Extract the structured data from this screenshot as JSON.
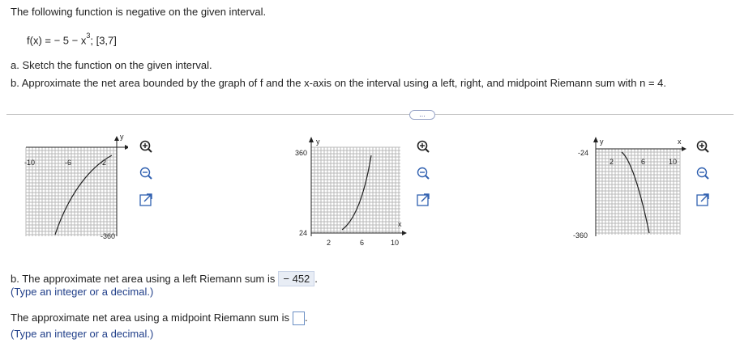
{
  "problem": {
    "intro": "The following function is negative on the given interval.",
    "function_prefix": "f(x) = − 5 − x",
    "function_exp": "3",
    "function_suffix": "; [3,7]",
    "part_a": "a. Sketch the function on the given interval.",
    "part_b": "b. Approximate the net area bounded by the graph of f and the x-axis on the interval using a left, right, and midpoint Riemann sum with n = 4."
  },
  "more_button": "...",
  "graphs": [
    {
      "ticks": [
        "-10",
        "-6",
        "-2",
        "-360"
      ],
      "axis_labels": {
        "y": "y",
        "x": ""
      },
      "curve": "A"
    },
    {
      "ticks": [
        "360",
        "24",
        "2",
        "6",
        "10"
      ],
      "axis_labels": {
        "y": "y",
        "x": "x"
      },
      "curve": "B"
    },
    {
      "ticks": [
        "-24",
        "2",
        "6",
        "10",
        "-360"
      ],
      "axis_labels": {
        "y": "y",
        "x": "x"
      },
      "curve": "C"
    }
  ],
  "controls": {
    "zoom_in": "zoom-in-icon",
    "zoom_out": "zoom-out-icon",
    "expand": "expand-icon"
  },
  "answers": {
    "left_label": "b. The approximate net area using a left Riemann sum is",
    "left_value": "− 452",
    "left_hint": "(Type an integer or a decimal.)",
    "mid_label": "The approximate net area using a midpoint Riemann sum is",
    "mid_value": "",
    "mid_hint": "(Type an integer or a decimal.)"
  }
}
